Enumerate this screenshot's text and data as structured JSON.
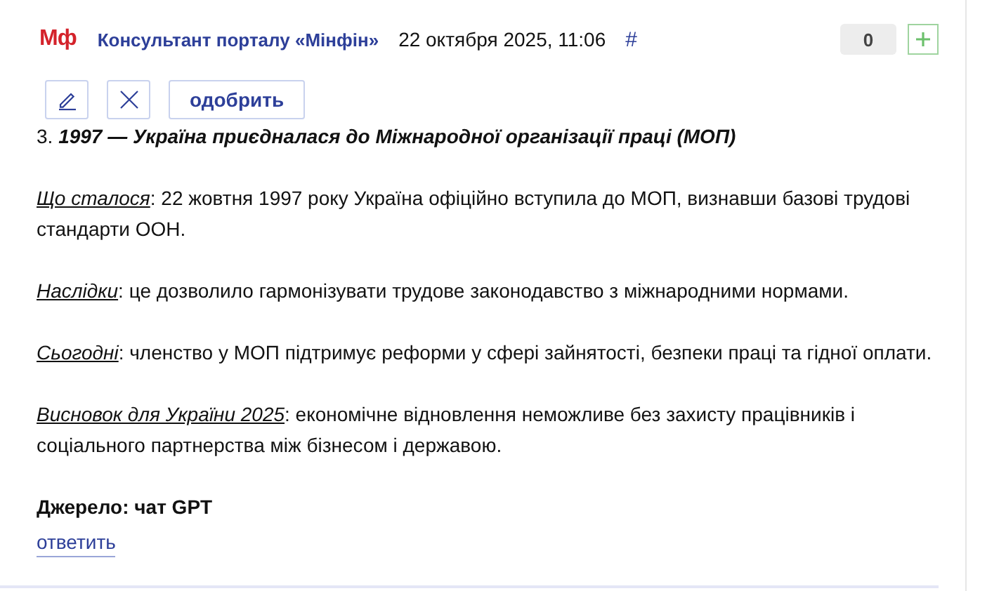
{
  "comment": {
    "logo": "Мф",
    "author": "Консультант порталу «Мінфін»",
    "date": "22 октября 2025, 11:06",
    "anchor": "#",
    "votes": "0",
    "actions": [
      {
        "kind": "edit"
      },
      {
        "kind": "delete"
      },
      {
        "kind": "text",
        "label": "одобрить"
      }
    ],
    "heading": {
      "number": "3.",
      "title": "1997 — Україна приєдналася до Міжнародної організації праці (МОП)"
    },
    "paragraphs": [
      {
        "term": "Що сталося",
        "text": ": 22 жовтня 1997 року Україна офіційно вступила до МОП, визнавши базові трудові стандарти ООН."
      },
      {
        "term": "Наслідки",
        "text": ": це дозволило гармонізувати трудове законодавство з міжнародними нормами."
      },
      {
        "term": "Сьогодні",
        "text": ": членство у МОП підтримує реформи у сфері зайнятості, безпеки праці та гідної оплати."
      },
      {
        "term": "Висновок для України 2025",
        "text": ": економічне відновлення неможливе без захисту працівників і соціального партнерства між бізнесом і державою."
      }
    ],
    "source": "Джерело: чат GPT",
    "reply": "ответить"
  }
}
